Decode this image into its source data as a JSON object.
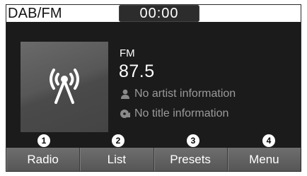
{
  "status_bar": {
    "source": "DAB/FM",
    "clock": "00:00"
  },
  "album_art": {
    "icon": "broadcast-antenna-icon"
  },
  "station": {
    "band": "FM",
    "frequency": "87.5",
    "artist": "No artist information",
    "title": "No title information",
    "artist_icon": "person-icon",
    "title_icon": "music-disc-icon"
  },
  "callouts": [
    "1",
    "2",
    "3",
    "4"
  ],
  "softkeys": [
    {
      "label": "Radio"
    },
    {
      "label": "List"
    },
    {
      "label": "Presets"
    },
    {
      "label": "Menu"
    }
  ],
  "colors": {
    "screen_bg": "#1b1b1b",
    "status_bg": "#ffffff",
    "softkey_bg": "#626262",
    "secondary_text": "#9a9a9a"
  }
}
